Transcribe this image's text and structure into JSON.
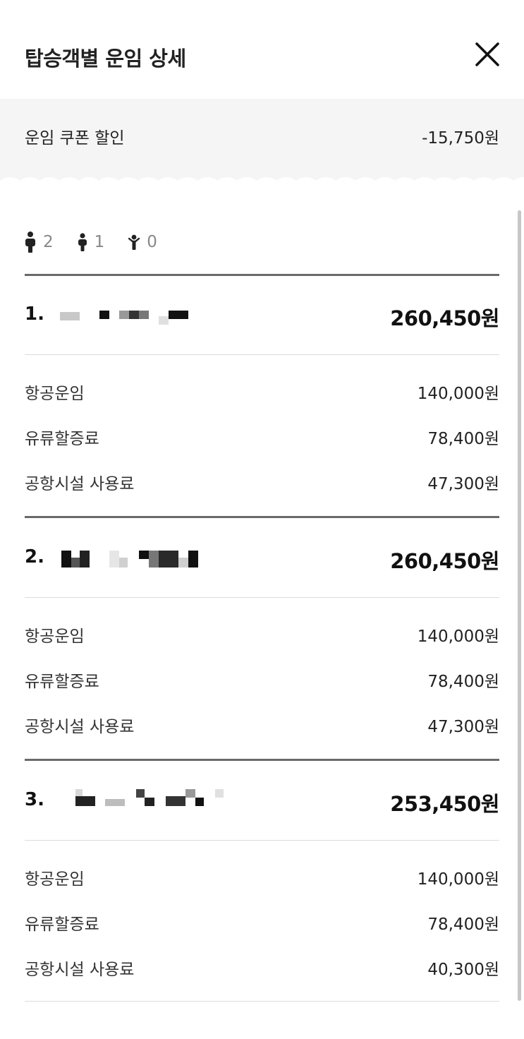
{
  "header": {
    "title": "탑승객별 운임 상세"
  },
  "coupon": {
    "label": "운임 쿠폰 할인",
    "value": "-15,750원"
  },
  "pax": [
    {
      "icon": "adult-icon",
      "count": "2"
    },
    {
      "icon": "child-icon",
      "count": "1"
    },
    {
      "icon": "infant-icon",
      "count": "0"
    }
  ],
  "passengers": [
    {
      "number": "1.",
      "total": "260,450원",
      "fares": [
        {
          "label": "항공운임",
          "value": "140,000원"
        },
        {
          "label": "유류할증료",
          "value": "78,400원"
        },
        {
          "label": "공항시설 사용료",
          "value": "47,300원"
        }
      ]
    },
    {
      "number": "2.",
      "total": "260,450원",
      "fares": [
        {
          "label": "항공운임",
          "value": "140,000원"
        },
        {
          "label": "유류할증료",
          "value": "78,400원"
        },
        {
          "label": "공항시설 사용료",
          "value": "47,300원"
        }
      ]
    },
    {
      "number": "3.",
      "total": "253,450원",
      "fares": [
        {
          "label": "항공운임",
          "value": "140,000원"
        },
        {
          "label": "유류할증료",
          "value": "78,400원"
        },
        {
          "label": "공항시설 사용료",
          "value": "40,300원"
        }
      ]
    }
  ]
}
